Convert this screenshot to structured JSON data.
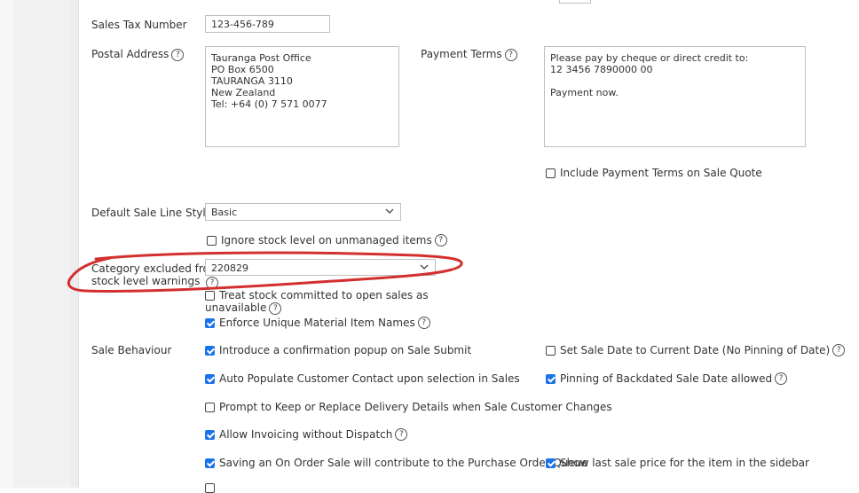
{
  "fields": {
    "sales_tax_number": {
      "label": "Sales Tax Number",
      "value": "123-456-789"
    },
    "postal_address": {
      "label": "Postal Address",
      "value": "Tauranga Post Office\nPO Box 6500\nTAURANGA 3110\nNew Zealand\nTel: +64 (0) 7 571 0077"
    },
    "payment_terms": {
      "label": "Payment Terms",
      "value": "Please pay by cheque or direct credit to:\n12 3456 7890000 00\n\nPayment now."
    },
    "include_payment_terms": {
      "label": "Include Payment Terms on Sale Quote",
      "checked": false
    },
    "default_sale_line_style": {
      "label": "Default Sale Line Style",
      "value": "Basic"
    },
    "ignore_stock_level": {
      "label": "Ignore stock level on unmanaged items",
      "checked": false
    },
    "category_excluded": {
      "label_line1": "Category excluded from",
      "label_line2": "stock level warnings",
      "value": "220829"
    },
    "treat_stock_committed": {
      "label_line1": "Treat stock committed to open sales as",
      "label_line2": "unavailable",
      "checked": false
    },
    "enforce_unique_names": {
      "label": "Enforce Unique Material Item Names",
      "checked": true
    }
  },
  "sale_behaviour": {
    "label": "Sale Behaviour",
    "options": {
      "confirm_popup": {
        "label": "Introduce a confirmation popup on Sale Submit",
        "checked": true
      },
      "set_sale_date": {
        "label": "Set Sale Date to Current Date (No Pinning of Date)",
        "checked": false
      },
      "auto_populate_contact": {
        "label": "Auto Populate Customer Contact upon selection in Sales",
        "checked": true
      },
      "pinning_backdated": {
        "label": "Pinning of Backdated Sale Date allowed",
        "checked": true
      },
      "prompt_keep_replace": {
        "label": "Prompt to Keep or Replace Delivery Details when Sale Customer Changes",
        "checked": false
      },
      "allow_invoicing": {
        "label": "Allow Invoicing without Dispatch",
        "checked": true
      },
      "on_order_sale": {
        "label": "Saving an On Order Sale will contribute to the Purchase Order Queue",
        "checked": true
      },
      "show_last_price": {
        "label": "Show last sale price for the item in the sidebar",
        "checked": true
      }
    }
  },
  "icons": {
    "help": "?",
    "help_name": "help-circle-icon",
    "chevron": "chevron-down-icon"
  },
  "colors": {
    "checkbox_checked": "#1a73e8",
    "annotation": "#d32f2f"
  }
}
